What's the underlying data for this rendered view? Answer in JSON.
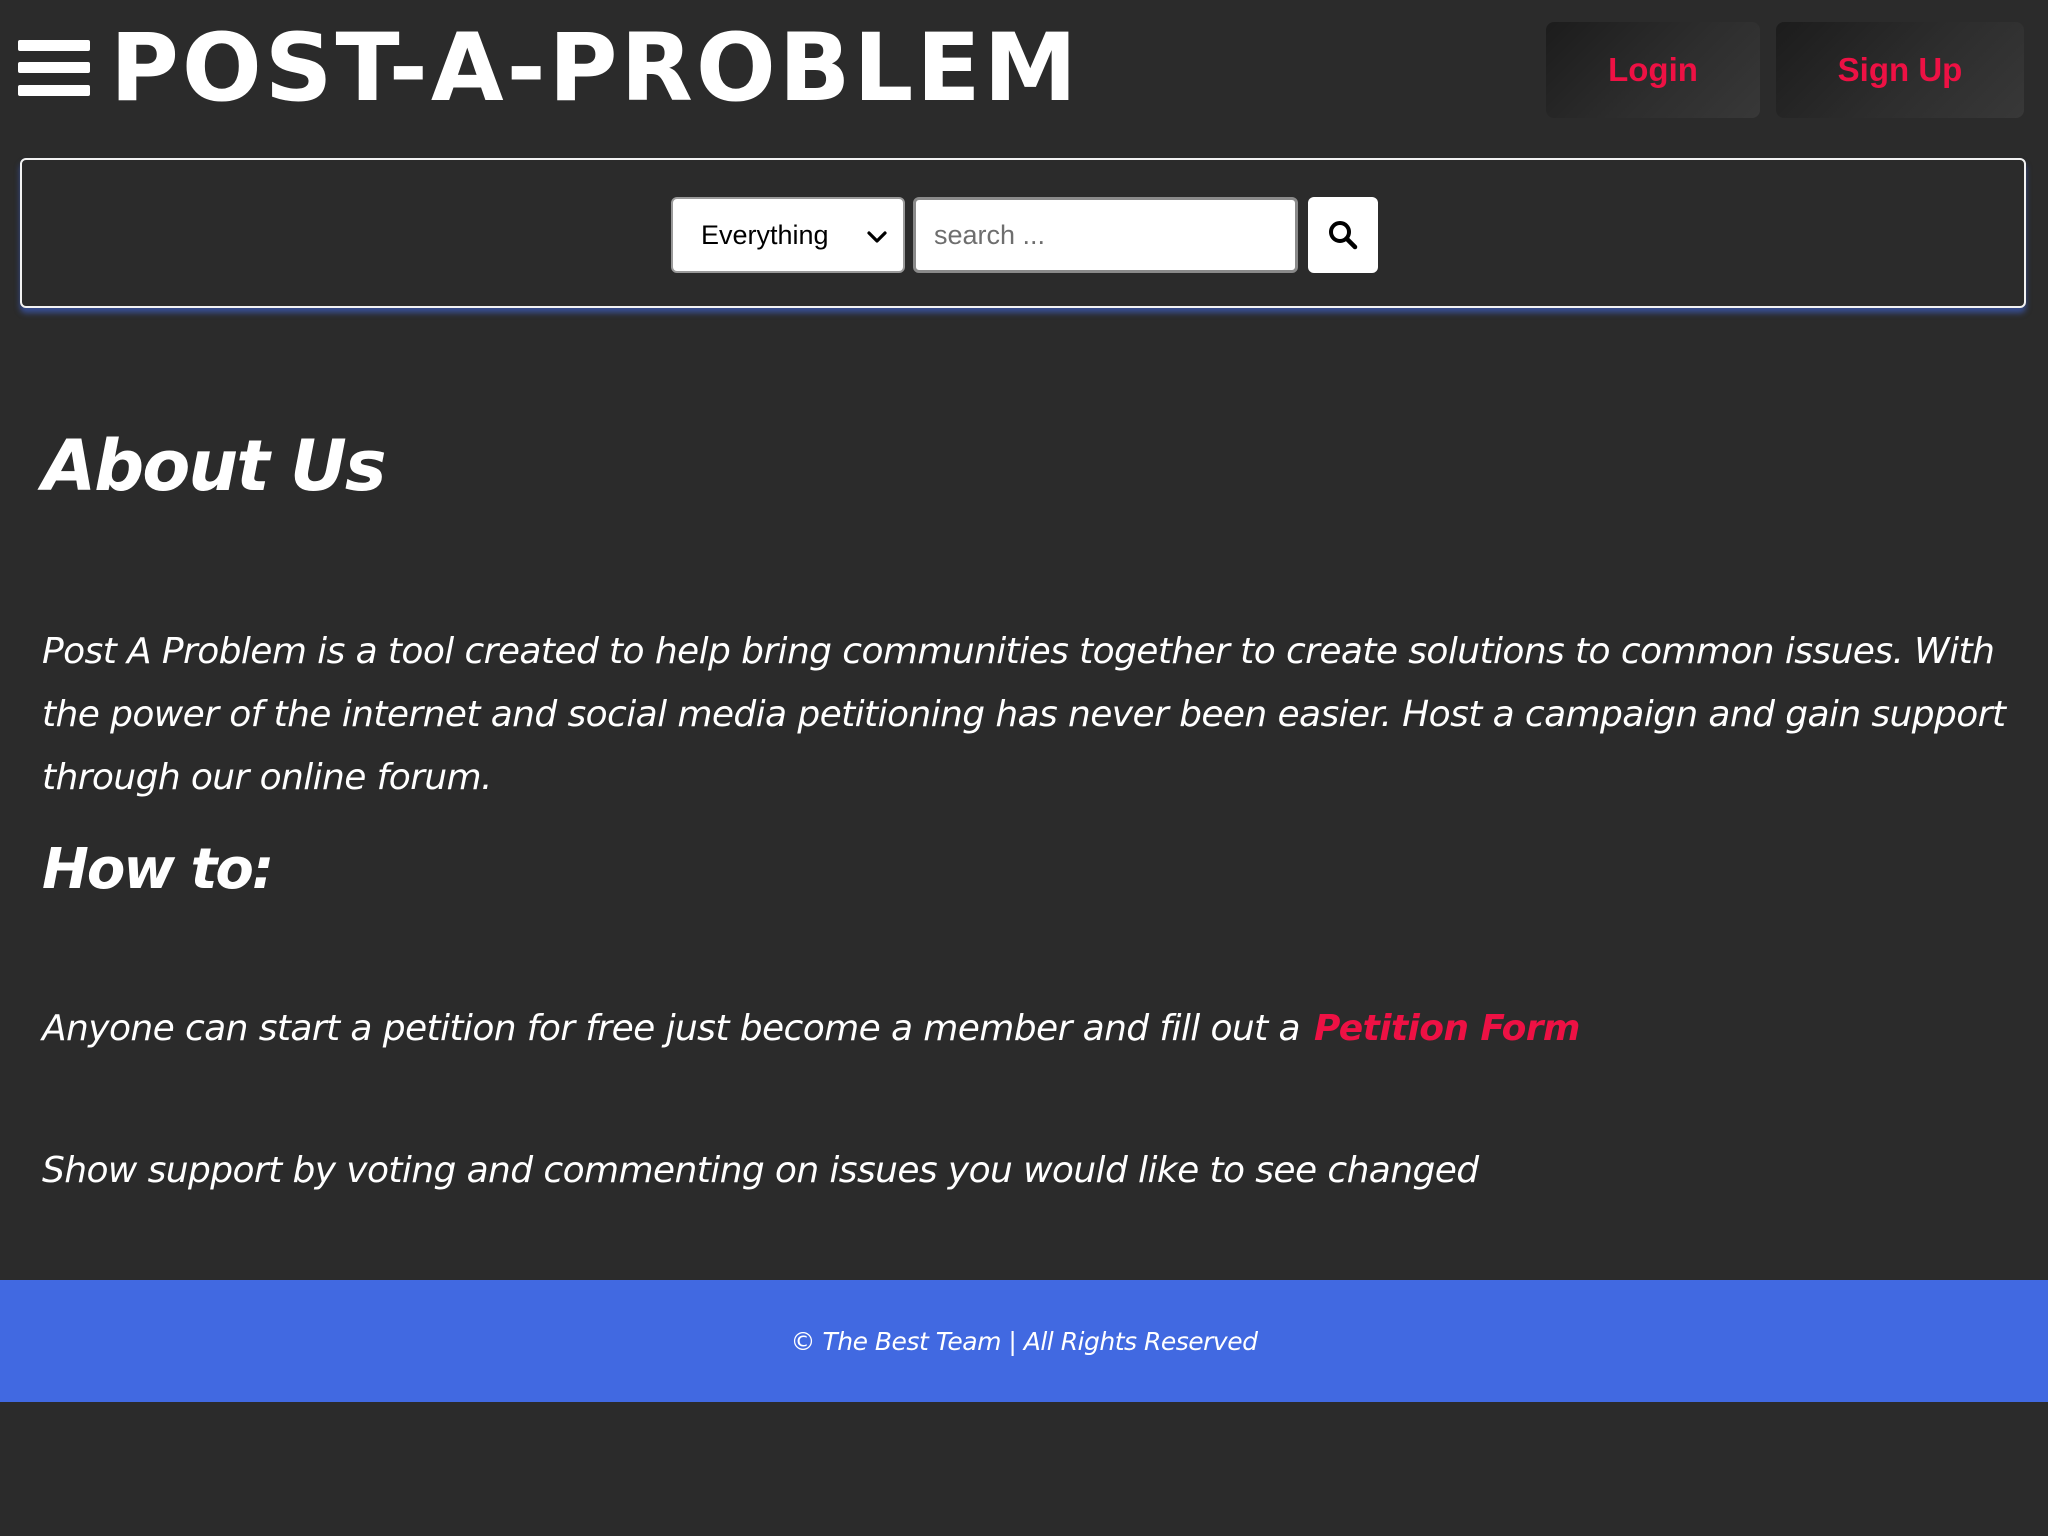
{
  "header": {
    "menu_icon": "hamburger-menu-icon",
    "logo_text": "POST-A-PROBLEM",
    "login_label": "Login",
    "signup_label": "Sign Up"
  },
  "search": {
    "category_selected": "Everything",
    "placeholder": "search ...",
    "value": "",
    "button_icon": "search-icon"
  },
  "about": {
    "heading": "About Us",
    "body": "Post A Problem is a tool created to help bring communities together to create solutions to common issues. With the power of the internet and social media petitioning has never been easier. Host a campaign and gain support through our online forum."
  },
  "howto": {
    "heading": "How to:",
    "start_text": "Anyone can start a petition for free just become a member and fill out a",
    "petition_link": "Petition Form",
    "support_text": "Show support by voting and commenting on issues you would like to see changed"
  },
  "footer": {
    "text": "© The Best Team | All Rights Reserved"
  },
  "colors": {
    "background": "#2b2b2b",
    "accent_red": "#ee1144",
    "footer_blue": "#4169e1",
    "text": "#ffffff"
  }
}
